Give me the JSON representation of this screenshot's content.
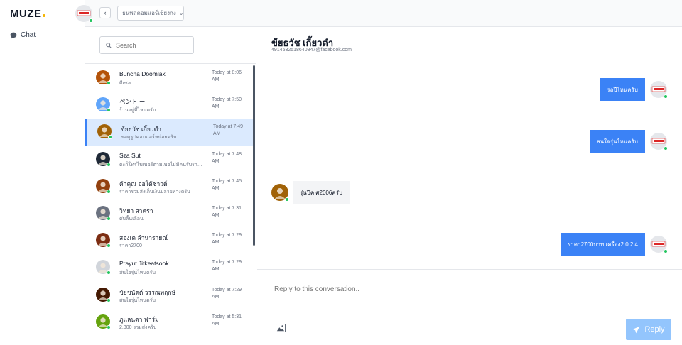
{
  "app": {
    "brand": "MUZE",
    "nav": [
      {
        "label": "Chat",
        "icon": "chat-bubble-icon"
      }
    ]
  },
  "topbar": {
    "page_select": "ธนพลคอมแอร์เชียงกง"
  },
  "search": {
    "placeholder": "Search"
  },
  "conversations": [
    {
      "name": "Buncha Doomlak",
      "preview": "ดีเซล",
      "time": "Today at 8:06 AM",
      "avatar_color": "#b45309"
    },
    {
      "name": "ペント ー",
      "preview": "ร้านอยู่ที่ไหนครับ",
      "time": "Today at 7:50 AM",
      "avatar_color": "#60a5fa"
    },
    {
      "name": "ข้ยธวัช เกี้ยวดำ",
      "preview": "ขอดูรูปคอมแอร์หน่อยครับ",
      "time": "Today at 7:49 AM",
      "avatar_color": "#a16207",
      "active": true
    },
    {
      "name": "Sza Sut",
      "preview": "ตะก็โทรไปเบอร์ตามเพจไม่มีคนรับรายละ...",
      "time": "Today at 7:48 AM",
      "avatar_color": "#1f2937"
    },
    {
      "name": "ค้าคูณ ออโต้ซาวด์",
      "preview": "ราคารวมส่งเก็บเงินปลายทางครับ",
      "time": "Today at 7:45 AM",
      "avatar_color": "#92400e"
    },
    {
      "name": "วิทยา สาครา",
      "preview": "ตับลื้นเลื่อน",
      "time": "Today at 7:31 AM",
      "avatar_color": "#6b7280"
    },
    {
      "name": "สองเค ลำนารายณ์",
      "preview": "ราคา2700",
      "time": "Today at 7:29 AM",
      "avatar_color": "#7c2d12"
    },
    {
      "name": "Prayut Jitkeatsook",
      "preview": "สนใจรุ่นไหนครับ",
      "time": "Today at 7:29 AM",
      "avatar_color": "#d1d5db"
    },
    {
      "name": "ข้ยชนัดต์ วรรณพฤกษ์",
      "preview": "สนใจรุ่นไหนครับ",
      "time": "Today at 7:29 AM",
      "avatar_color": "#451a03"
    },
    {
      "name": "ภูแลนดา ฟาร์ม",
      "preview": "2,300 รวมส่งครับ",
      "time": "Today at 5:31 AM",
      "avatar_color": "#65a30d"
    }
  ],
  "chat": {
    "title": "ข้ยธวัช เกี้ยวดำ",
    "subtitle": "4914532518640847@facebook.com",
    "messages": [
      {
        "dir": "out",
        "text": "รถปีไหนครับ"
      },
      {
        "dir": "out",
        "text": "สนใจรุ่นไหนครับ"
      },
      {
        "dir": "in",
        "text": "รุ่นปีค.ศ2006ครับ"
      },
      {
        "dir": "out",
        "text": "ราคา2700บาท เครื่อง2.0 2.4"
      }
    ],
    "composer_placeholder": "Reply to this conversation..",
    "reply_label": "Reply"
  },
  "colors": {
    "accent": "#3b82f6",
    "active_row": "#dbeafe",
    "online": "#22c55e",
    "reply_disabled": "#93c5fd",
    "brand_dot": "#f5b400"
  }
}
